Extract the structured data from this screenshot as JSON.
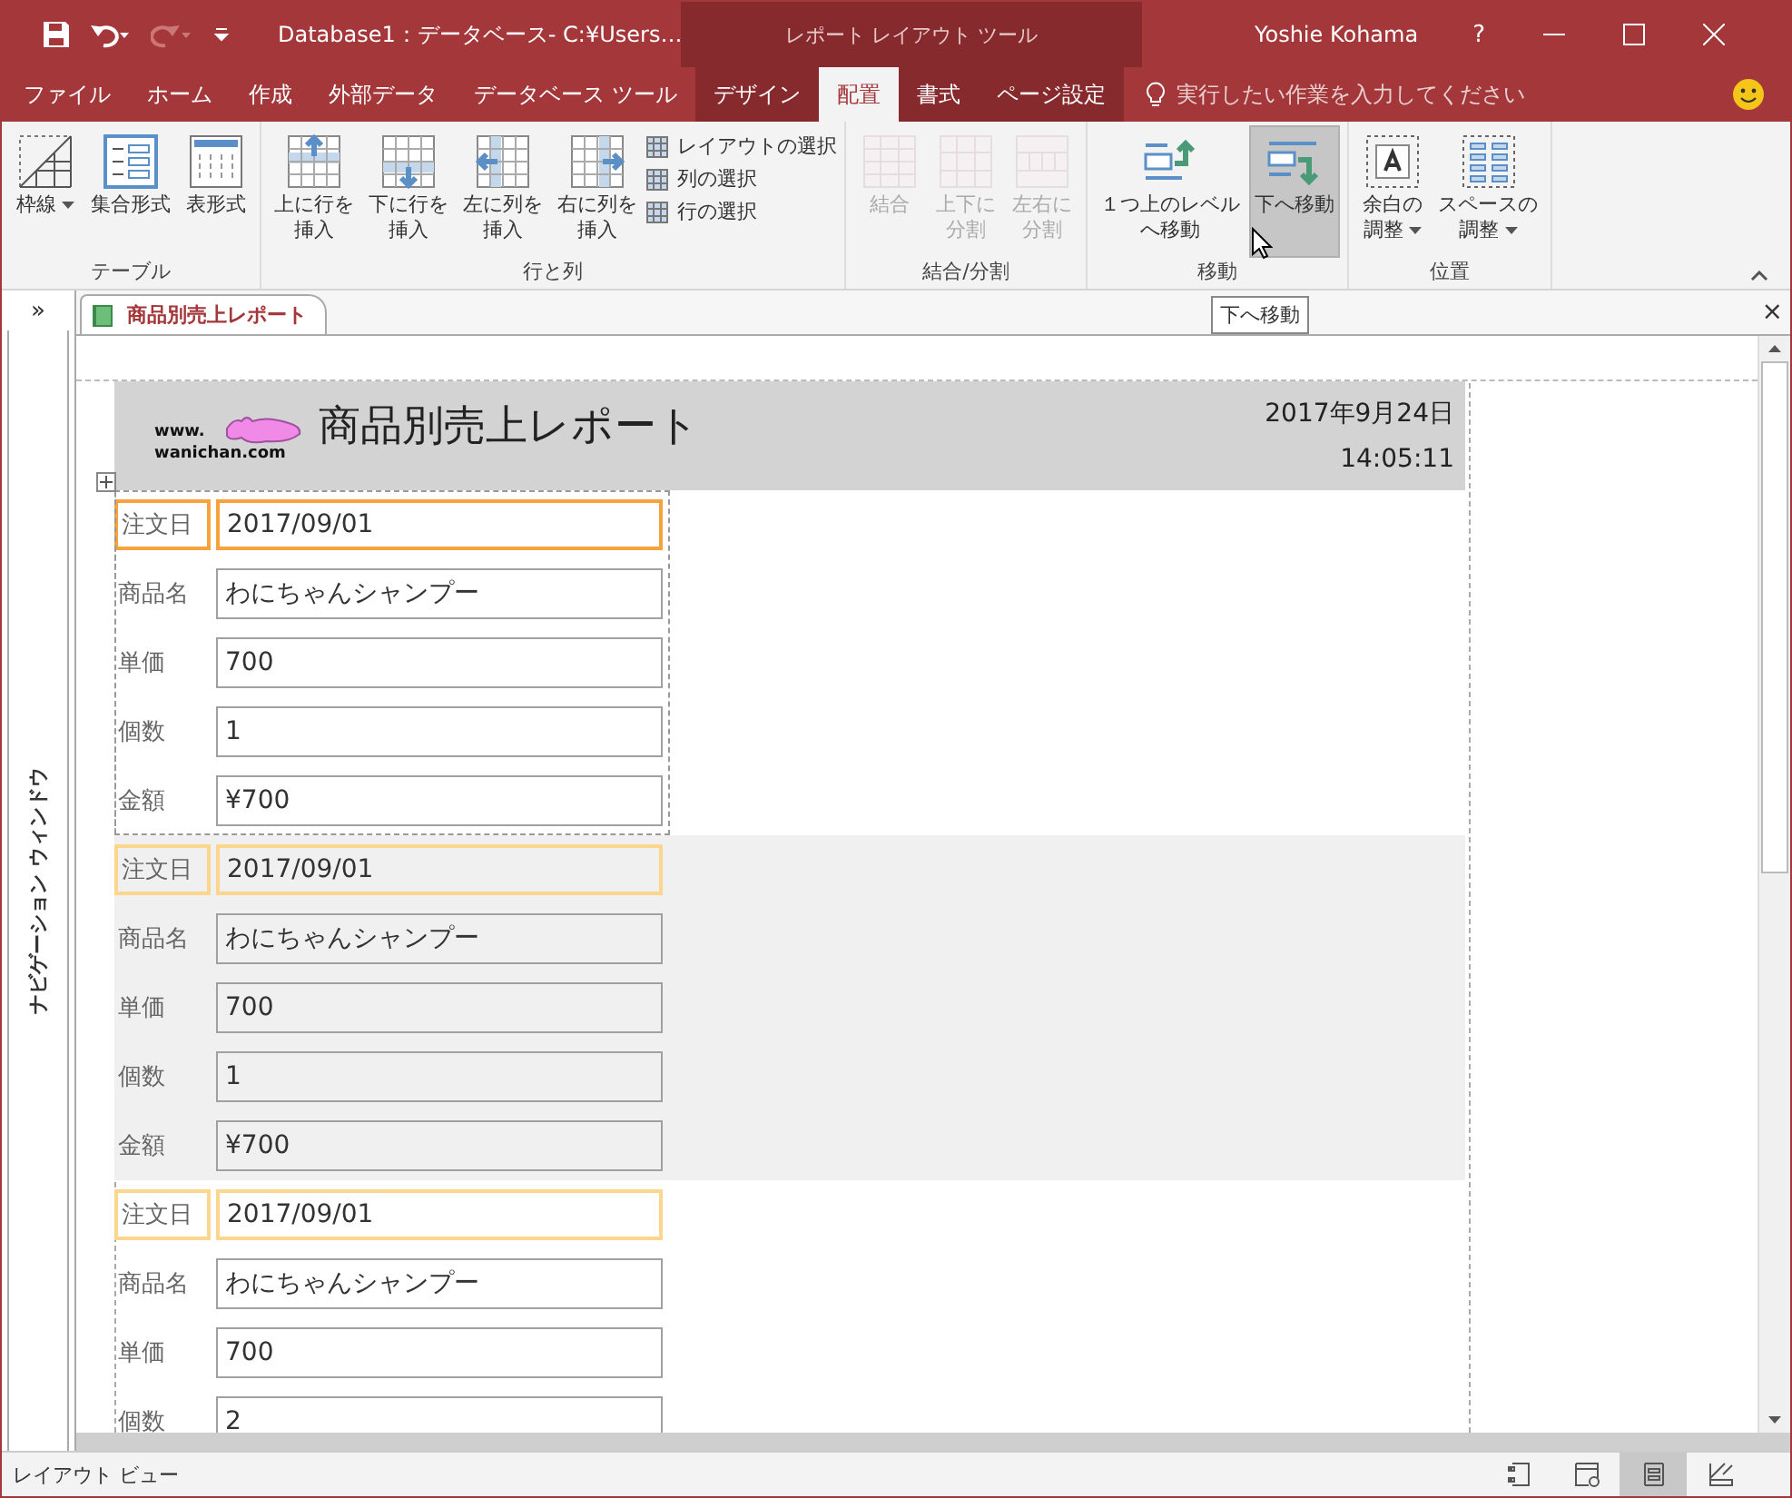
{
  "window": {
    "title": "Database1：データベース- C:¥Users…",
    "context_tool": "レポート レイアウト ツール",
    "user": "Yoshie Kohama",
    "help": "?"
  },
  "ribbon_tabs": [
    {
      "label": "ファイル",
      "selected": false,
      "contextual": false
    },
    {
      "label": "ホーム",
      "selected": false,
      "contextual": false
    },
    {
      "label": "作成",
      "selected": false,
      "contextual": false
    },
    {
      "label": "外部データ",
      "selected": false,
      "contextual": false
    },
    {
      "label": "データベース ツール",
      "selected": false,
      "contextual": false
    },
    {
      "label": "デザイン",
      "selected": false,
      "contextual": true
    },
    {
      "label": "配置",
      "selected": true,
      "contextual": true
    },
    {
      "label": "書式",
      "selected": false,
      "contextual": true
    },
    {
      "label": "ページ設定",
      "selected": false,
      "contextual": true
    }
  ],
  "tell_me": {
    "placeholder": "実行したい作業を入力してください"
  },
  "ribbon_groups": [
    {
      "label": "テーブル",
      "items": [
        {
          "kind": "large",
          "label": [
            "枠線"
          ],
          "dropdown": true,
          "disabled": false,
          "hovered": false
        },
        {
          "kind": "large",
          "label": [
            "集合形式"
          ],
          "dropdown": false,
          "disabled": false,
          "hovered": false
        },
        {
          "kind": "large",
          "label": [
            "表形式"
          ],
          "dropdown": false,
          "disabled": false,
          "hovered": false
        }
      ]
    },
    {
      "label": "行と列",
      "items": [
        {
          "kind": "large",
          "label": [
            "上に行を",
            "挿入"
          ],
          "dropdown": false,
          "disabled": false,
          "hovered": false
        },
        {
          "kind": "large",
          "label": [
            "下に行を",
            "挿入"
          ],
          "dropdown": false,
          "disabled": false,
          "hovered": false
        },
        {
          "kind": "large",
          "label": [
            "左に列を",
            "挿入"
          ],
          "dropdown": false,
          "disabled": false,
          "hovered": false
        },
        {
          "kind": "large",
          "label": [
            "右に列を",
            "挿入"
          ],
          "dropdown": false,
          "disabled": false,
          "hovered": false
        },
        {
          "kind": "small",
          "label": [
            "レイアウトの選択"
          ]
        },
        {
          "kind": "small",
          "label": [
            "列の選択"
          ]
        },
        {
          "kind": "small",
          "label": [
            "行の選択"
          ]
        }
      ]
    },
    {
      "label": "結合/分割",
      "items": [
        {
          "kind": "large",
          "label": [
            "結合"
          ],
          "dropdown": false,
          "disabled": true,
          "hovered": false
        },
        {
          "kind": "large",
          "label": [
            "上下に",
            "分割"
          ],
          "dropdown": false,
          "disabled": true,
          "hovered": false
        },
        {
          "kind": "large",
          "label": [
            "左右に",
            "分割"
          ],
          "dropdown": false,
          "disabled": true,
          "hovered": false
        }
      ]
    },
    {
      "label": "移動",
      "items": [
        {
          "kind": "large",
          "label": [
            "１つ上のレベル",
            "へ移動"
          ],
          "dropdown": false,
          "disabled": false,
          "hovered": false
        },
        {
          "kind": "large",
          "label": [
            "下へ移動"
          ],
          "dropdown": false,
          "disabled": false,
          "hovered": true
        }
      ]
    },
    {
      "label": "位置",
      "items": [
        {
          "kind": "large",
          "label": [
            "余白の",
            "調整"
          ],
          "dropdown": true,
          "disabled": false,
          "hovered": false
        },
        {
          "kind": "large",
          "label": [
            "スペースの",
            "調整"
          ],
          "dropdown": true,
          "disabled": false,
          "hovered": false
        }
      ]
    }
  ],
  "tooltip": "下へ移動",
  "navigation_pane": {
    "label": "ナビゲーション ウィンドウ",
    "toggle": "»"
  },
  "document_tab": {
    "label": "商品別売上レポート",
    "close": "×"
  },
  "report": {
    "logo": {
      "line_1": "www.",
      "line_2": "wanichan.com"
    },
    "title": "商品別売上レポート",
    "date": "2017年9月24日",
    "time": "14:05:11",
    "records": [
      {
        "selected": true,
        "alternate": false,
        "fields": [
          {
            "label": "注文日",
            "value": "2017/09/01",
            "highlighted": true
          },
          {
            "label": "商品名",
            "value": "わにちゃんシャンプー",
            "highlighted": false
          },
          {
            "label": "単価",
            "value": "700",
            "highlighted": false
          },
          {
            "label": "個数",
            "value": "1",
            "highlighted": false
          },
          {
            "label": "金額",
            "value": "¥700",
            "highlighted": false
          }
        ]
      },
      {
        "selected": false,
        "alternate": true,
        "fields": [
          {
            "label": "注文日",
            "value": "2017/09/01",
            "highlighted": true
          },
          {
            "label": "商品名",
            "value": "わにちゃんシャンプー",
            "highlighted": false
          },
          {
            "label": "単価",
            "value": "700",
            "highlighted": false
          },
          {
            "label": "個数",
            "value": "1",
            "highlighted": false
          },
          {
            "label": "金額",
            "value": "¥700",
            "highlighted": false
          }
        ]
      },
      {
        "selected": false,
        "alternate": false,
        "fields": [
          {
            "label": "注文日",
            "value": "2017/09/01",
            "highlighted": true
          },
          {
            "label": "商品名",
            "value": "わにちゃんシャンプー",
            "highlighted": false
          },
          {
            "label": "単価",
            "value": "700",
            "highlighted": false
          },
          {
            "label": "個数",
            "value": "2",
            "highlighted": false
          }
        ]
      }
    ]
  },
  "status_bar": {
    "text": "レイアウト ビュー",
    "views": [
      {
        "selected": false
      },
      {
        "selected": false
      },
      {
        "selected": true
      },
      {
        "selected": false
      }
    ]
  }
}
